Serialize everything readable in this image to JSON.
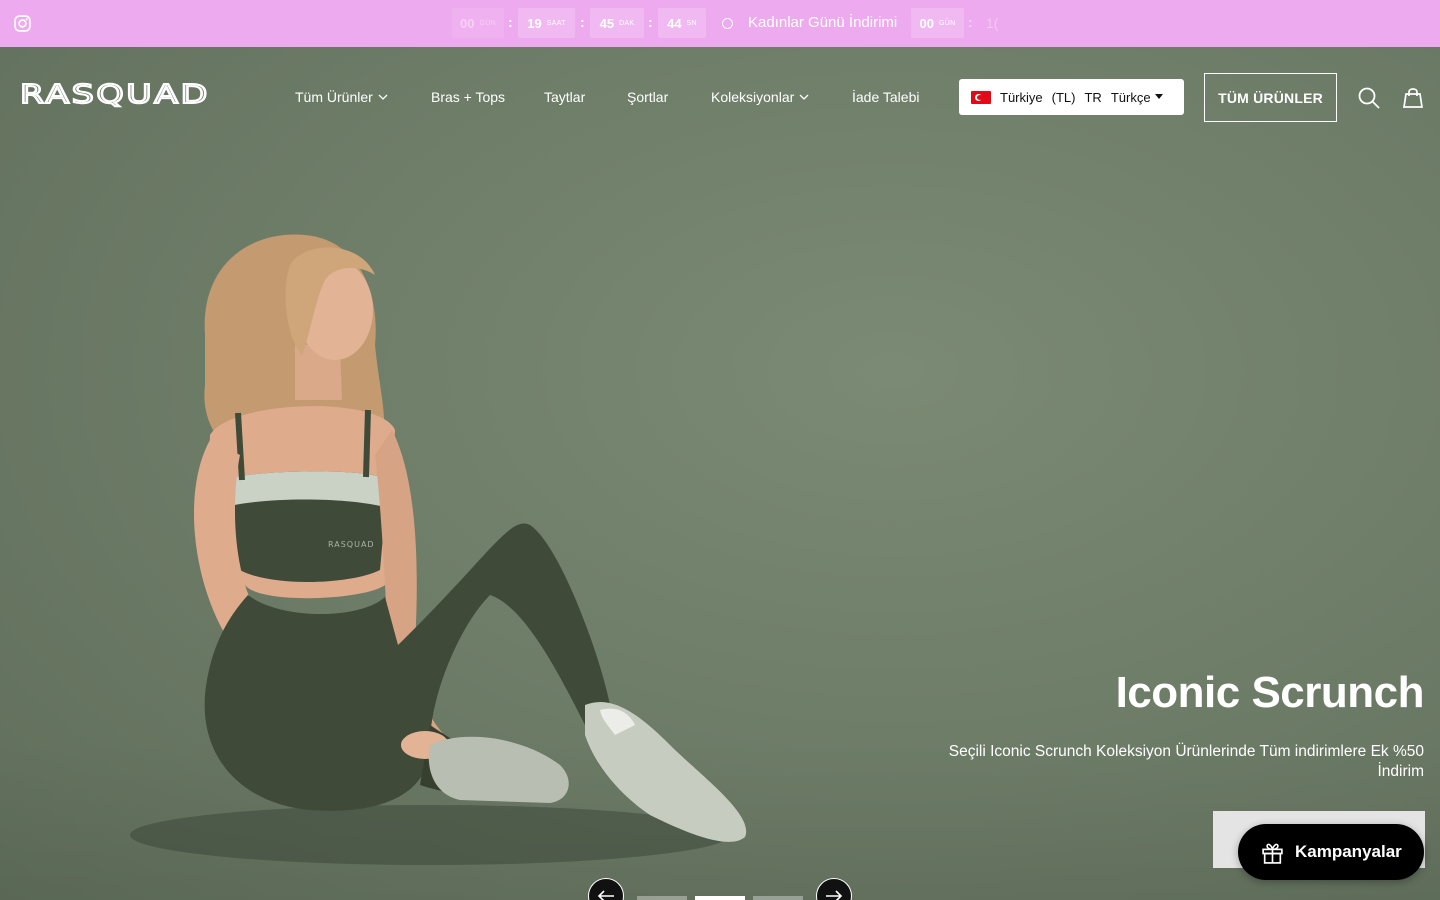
{
  "announcement": {
    "countdown_left": [
      {
        "value": "00",
        "unit": "GÜN"
      },
      {
        "value": "19",
        "unit": "SAAT"
      },
      {
        "value": "45",
        "unit": "DAK"
      },
      {
        "value": "44",
        "unit": "SN"
      }
    ],
    "separator": ":",
    "promo_text": "Kadınlar Günü İndirimi",
    "countdown_right": {
      "value": "00",
      "unit": "GÜN"
    },
    "trail_text": "1("
  },
  "header": {
    "brand": "RASQUAD",
    "nav": [
      {
        "label": "Tüm Ürünler",
        "has_dropdown": true
      },
      {
        "label": "Bras + Tops",
        "has_dropdown": false
      },
      {
        "label": "Taytlar",
        "has_dropdown": false
      },
      {
        "label": "Şortlar",
        "has_dropdown": false
      },
      {
        "label": "Koleksiyonlar",
        "has_dropdown": true
      },
      {
        "label": "İade Talebi",
        "has_dropdown": false
      }
    ],
    "locale": {
      "country": "Türkiye",
      "currency": "(TL)",
      "lang_code": "TR",
      "language": "Türkçe"
    },
    "all_products_button": "TÜM ÜRÜNLER",
    "icons": [
      "instagram-icon",
      "search-icon",
      "shopping-bag-icon"
    ]
  },
  "hero": {
    "title": "Iconic Scrunch",
    "subtitle": "Seçili Iconic Scrunch Koleksiyon Ürünlerinde Tüm indirimlere Ek %50 İndirim",
    "bra_print": "RASQUAD",
    "slides_count": 3,
    "active_slide": 2
  },
  "campaign_button": {
    "label": "Kampanyalar",
    "icon": "gift-icon"
  },
  "colors": {
    "topbar": "#eeaaee",
    "hero_bg": "#6f7d69",
    "outfit": "#3f4a38",
    "button_dark": "#000000"
  }
}
